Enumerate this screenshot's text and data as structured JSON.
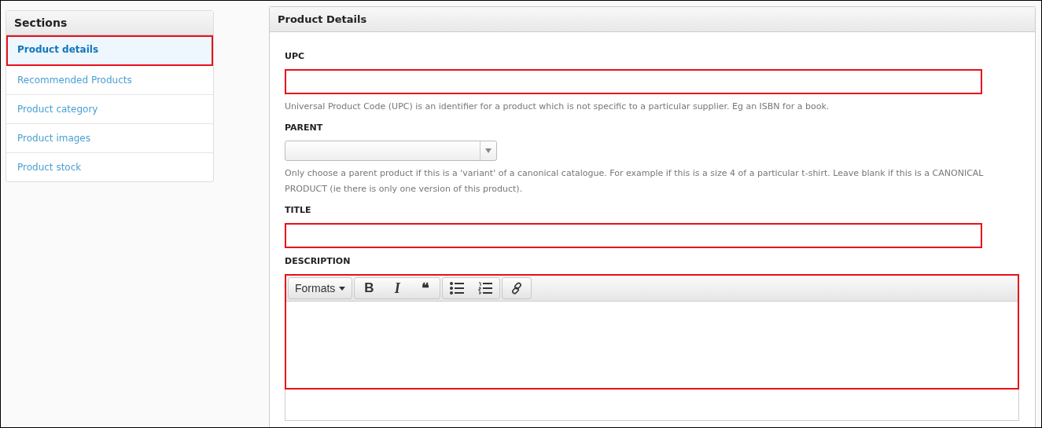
{
  "sidebar": {
    "title": "Sections",
    "items": [
      {
        "label": "Product details",
        "selected": true,
        "highlighted": true
      },
      {
        "label": "Recommended Products",
        "selected": false,
        "highlighted": false
      },
      {
        "label": "Product category",
        "selected": false,
        "highlighted": false
      },
      {
        "label": "Product images",
        "selected": false,
        "highlighted": false
      },
      {
        "label": "Product stock",
        "selected": false,
        "highlighted": false
      }
    ]
  },
  "panel": {
    "title": "Product Details",
    "fields": [
      {
        "kind": "text",
        "label": "UPC",
        "highlighted": true,
        "help": "Universal Product Code (UPC) is an identifier for a product which is not specific to a particular supplier. Eg an ISBN for a book."
      },
      {
        "kind": "select",
        "label": "PARENT",
        "highlighted": false,
        "help": "Only choose a parent product if this is a 'variant' of a canonical catalogue. For example if this is a size 4 of a particular t-shirt. Leave blank if this is a CANONICAL PRODUCT (ie there is only one version of this product)."
      },
      {
        "kind": "text",
        "label": "TITLE",
        "highlighted": true
      },
      {
        "kind": "editor",
        "label": "DESCRIPTION",
        "highlighted": true,
        "toolbar": [
          [
            {
              "kind": "dropdown",
              "label": "Formats"
            }
          ],
          [
            {
              "kind": "bold",
              "label": "B"
            },
            {
              "kind": "italic",
              "label": "I"
            },
            {
              "kind": "quote",
              "label": "❝"
            }
          ],
          [
            {
              "kind": "bullets"
            },
            {
              "kind": "numbers"
            }
          ],
          [
            {
              "kind": "link"
            }
          ]
        ]
      }
    ]
  }
}
